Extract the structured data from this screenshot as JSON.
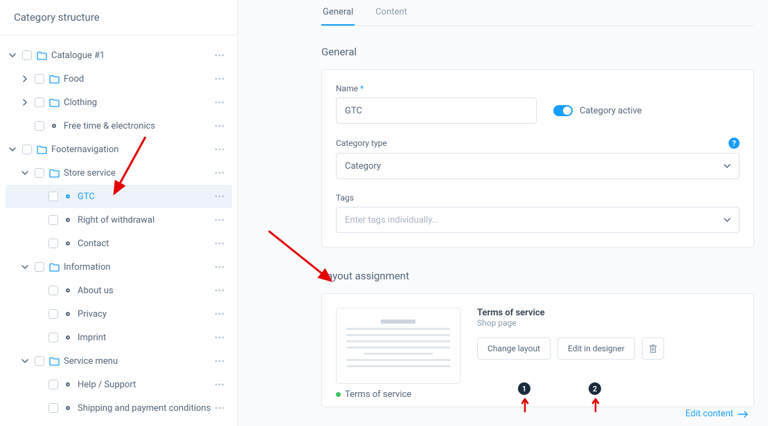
{
  "sidebar": {
    "title": "Category structure",
    "items": [
      {
        "label": "Catalogue #1",
        "level": 0,
        "caret": "down",
        "folder": true
      },
      {
        "label": "Food",
        "level": 1,
        "caret": "right",
        "folder": true
      },
      {
        "label": "Clothing",
        "level": 1,
        "caret": "right",
        "folder": true
      },
      {
        "label": "Free time & electronics",
        "level": 1,
        "caret": "none",
        "dot": true
      },
      {
        "label": "Footernavigation",
        "level": 0,
        "caret": "down",
        "folder": true
      },
      {
        "label": "Store service",
        "level": 1,
        "caret": "down",
        "folder": true
      },
      {
        "label": "GTC",
        "level": 2,
        "caret": "none",
        "dot": true,
        "active": true,
        "selected": true
      },
      {
        "label": "Right of withdrawal",
        "level": 2,
        "caret": "none",
        "dot": true
      },
      {
        "label": "Contact",
        "level": 2,
        "caret": "none",
        "dot": true
      },
      {
        "label": "Information",
        "level": 1,
        "caret": "down",
        "folder": true
      },
      {
        "label": "About us",
        "level": 2,
        "caret": "none",
        "dot": true
      },
      {
        "label": "Privacy",
        "level": 2,
        "caret": "none",
        "dot": true
      },
      {
        "label": "Imprint",
        "level": 2,
        "caret": "none",
        "dot": true
      },
      {
        "label": "Service menu",
        "level": 1,
        "caret": "down",
        "folder": true
      },
      {
        "label": "Help / Support",
        "level": 2,
        "caret": "none",
        "dot": true
      },
      {
        "label": "Shipping and payment conditions",
        "level": 2,
        "caret": "none",
        "dot": true
      }
    ]
  },
  "tabs": {
    "general": "General",
    "content": "Content"
  },
  "general": {
    "section_title": "General",
    "name_label": "Name",
    "name_value": "GTC",
    "active_label": "Category active",
    "type_label": "Category type",
    "type_value": "Category",
    "tags_label": "Tags",
    "tags_placeholder": "Enter tags individually..."
  },
  "layout": {
    "section_title": "Layout assignment",
    "name": "Terms of service",
    "type": "Shop page",
    "thumb_label": "Terms of service",
    "change_btn": "Change layout",
    "edit_btn": "Edit in designer",
    "edit_link": "Edit content"
  },
  "badges": {
    "one": "1",
    "two": "2"
  }
}
